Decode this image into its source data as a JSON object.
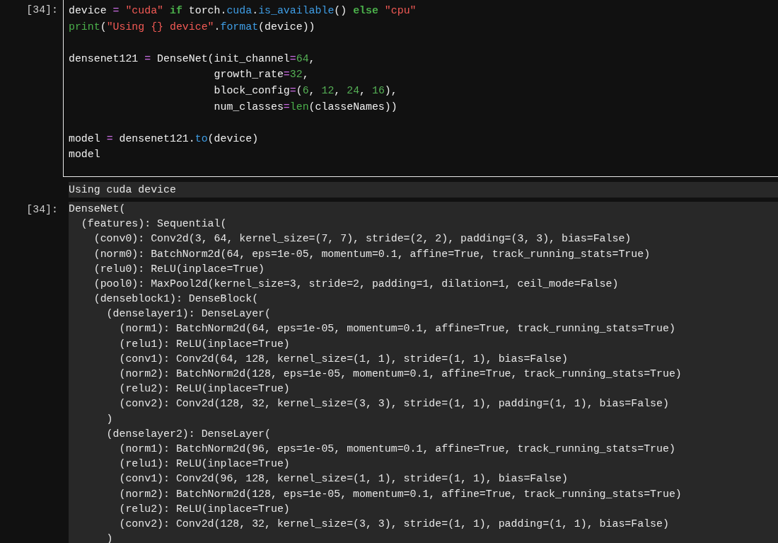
{
  "code_cell": {
    "prompt": "[34]:",
    "lines": [
      {
        "kind": "code",
        "tokens": [
          {
            "text": "device",
            "kind": "plain"
          },
          {
            "text": " = ",
            "kind": "op"
          },
          {
            "text": "\"cuda\"",
            "kind": "str"
          },
          {
            "text": " if ",
            "kind": "kw"
          },
          {
            "text": "torch.",
            "kind": "plain"
          },
          {
            "text": "cuda",
            "kind": "attr"
          },
          {
            "text": ".",
            "kind": "plain"
          },
          {
            "text": "is_available",
            "kind": "attr"
          },
          {
            "text": "() ",
            "kind": "plain"
          },
          {
            "text": "else ",
            "kind": "kw"
          },
          {
            "text": "\"cpu\"",
            "kind": "str"
          }
        ]
      },
      {
        "kind": "code",
        "tokens": [
          {
            "text": "print",
            "kind": "builtin"
          },
          {
            "text": "(",
            "kind": "plain"
          },
          {
            "text": "\"Using {} device\"",
            "kind": "str"
          },
          {
            "text": ".",
            "kind": "plain"
          },
          {
            "text": "format",
            "kind": "attr"
          },
          {
            "text": "(device))",
            "kind": "plain"
          }
        ]
      },
      {
        "kind": "blank"
      },
      {
        "kind": "code",
        "tokens": [
          {
            "text": "densenet121 ",
            "kind": "plain"
          },
          {
            "text": "=",
            "kind": "op"
          },
          {
            "text": " DenseNet(init_channel",
            "kind": "plain"
          },
          {
            "text": "=",
            "kind": "op"
          },
          {
            "text": "64",
            "kind": "num"
          },
          {
            "text": ",",
            "kind": "plain"
          }
        ]
      },
      {
        "kind": "code",
        "tokens": [
          {
            "text": "                       growth_rate",
            "kind": "plain"
          },
          {
            "text": "=",
            "kind": "op"
          },
          {
            "text": "32",
            "kind": "num"
          },
          {
            "text": ",",
            "kind": "plain"
          }
        ]
      },
      {
        "kind": "code",
        "tokens": [
          {
            "text": "                       block_config",
            "kind": "plain"
          },
          {
            "text": "=",
            "kind": "op"
          },
          {
            "text": "(",
            "kind": "plain"
          },
          {
            "text": "6",
            "kind": "num"
          },
          {
            "text": ", ",
            "kind": "plain"
          },
          {
            "text": "12",
            "kind": "num"
          },
          {
            "text": ", ",
            "kind": "plain"
          },
          {
            "text": "24",
            "kind": "num"
          },
          {
            "text": ", ",
            "kind": "plain"
          },
          {
            "text": "16",
            "kind": "num"
          },
          {
            "text": "),",
            "kind": "plain"
          }
        ]
      },
      {
        "kind": "code",
        "tokens": [
          {
            "text": "                       num_classes",
            "kind": "plain"
          },
          {
            "text": "=",
            "kind": "op"
          },
          {
            "text": "len",
            "kind": "builtin"
          },
          {
            "text": "(classeNames))",
            "kind": "plain"
          }
        ]
      },
      {
        "kind": "blank"
      },
      {
        "kind": "code",
        "tokens": [
          {
            "text": "model ",
            "kind": "plain"
          },
          {
            "text": "=",
            "kind": "op"
          },
          {
            "text": " densenet121.",
            "kind": "plain"
          },
          {
            "text": "to",
            "kind": "attr"
          },
          {
            "text": "(device)",
            "kind": "plain"
          }
        ]
      },
      {
        "kind": "code",
        "tokens": [
          {
            "text": "model",
            "kind": "plain"
          }
        ]
      }
    ]
  },
  "stream_output": {
    "text": "Using cuda device"
  },
  "result_output": {
    "prompt": "[34]:",
    "lines": [
      "DenseNet(",
      "  (features): Sequential(",
      "    (conv0): Conv2d(3, 64, kernel_size=(7, 7), stride=(2, 2), padding=(3, 3), bias=False)",
      "    (norm0): BatchNorm2d(64, eps=1e-05, momentum=0.1, affine=True, track_running_stats=True)",
      "    (relu0): ReLU(inplace=True)",
      "    (pool0): MaxPool2d(kernel_size=3, stride=2, padding=1, dilation=1, ceil_mode=False)",
      "    (denseblock1): DenseBlock(",
      "      (denselayer1): DenseLayer(",
      "        (norm1): BatchNorm2d(64, eps=1e-05, momentum=0.1, affine=True, track_running_stats=True)",
      "        (relu1): ReLU(inplace=True)",
      "        (conv1): Conv2d(64, 128, kernel_size=(1, 1), stride=(1, 1), bias=False)",
      "        (norm2): BatchNorm2d(128, eps=1e-05, momentum=0.1, affine=True, track_running_stats=True)",
      "        (relu2): ReLU(inplace=True)",
      "        (conv2): Conv2d(128, 32, kernel_size=(3, 3), stride=(1, 1), padding=(1, 1), bias=False)",
      "      )",
      "      (denselayer2): DenseLayer(",
      "        (norm1): BatchNorm2d(96, eps=1e-05, momentum=0.1, affine=True, track_running_stats=True)",
      "        (relu1): ReLU(inplace=True)",
      "        (conv1): Conv2d(96, 128, kernel_size=(1, 1), stride=(1, 1), bias=False)",
      "        (norm2): BatchNorm2d(128, eps=1e-05, momentum=0.1, affine=True, track_running_stats=True)",
      "        (relu2): ReLU(inplace=True)",
      "        (conv2): Conv2d(128, 32, kernel_size=(3, 3), stride=(1, 1), padding=(1, 1), bias=False)",
      "      )"
    ]
  }
}
